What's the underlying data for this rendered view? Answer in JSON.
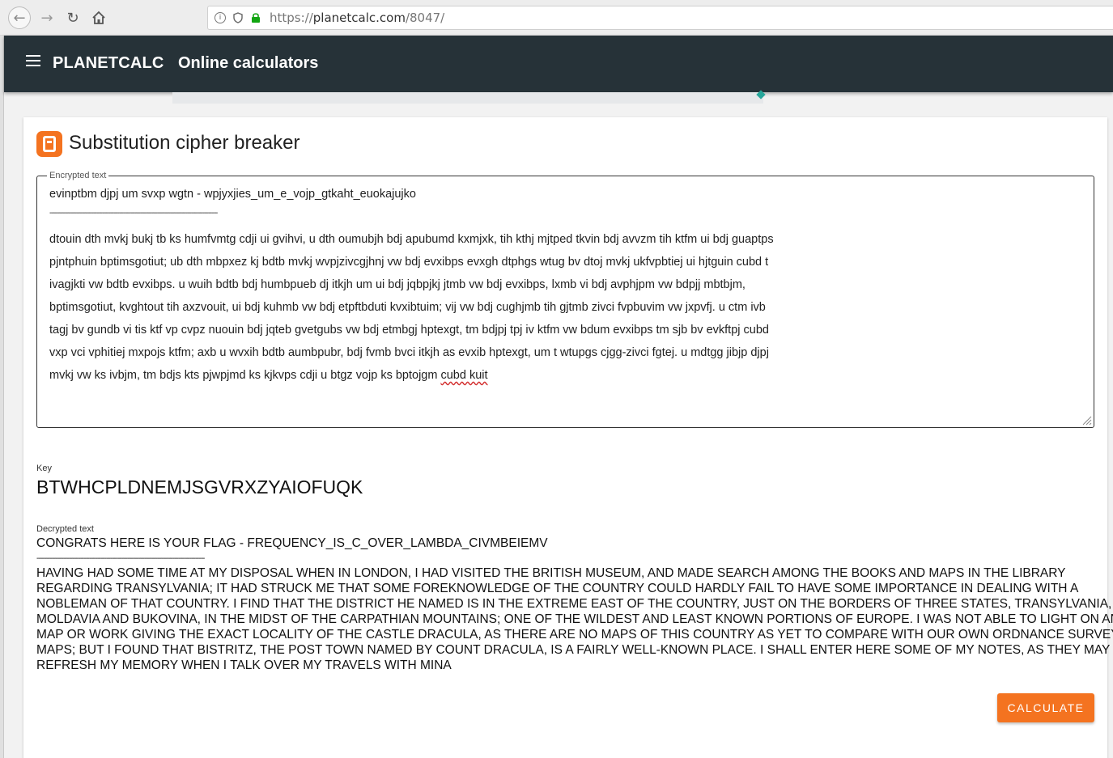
{
  "browser": {
    "url_prefix": "https://",
    "url_host": "planetcalc.com",
    "url_path": "/8047/"
  },
  "header": {
    "brand": "PLANETCALC",
    "title": "Online calculators"
  },
  "calculator": {
    "title": "Substitution cipher breaker",
    "encrypted_label": "Encrypted text",
    "encrypted_lines": [
      "evinptbm djpj um svxp wgtn - wpjyxjies_um_e_vojp_gtkaht_euokajujko",
      "-----------------------------------------------------------------------------------------",
      "dtouin dth mvkj bukj tb ks humfvmtg cdji ui gvihvi, u dth oumubjh bdj apubumd kxmjxk, tih kthj mjtped tkvin bdj avvzm tih ktfm ui bdj guaptps",
      "pjntphuin bptimsgotiut; ub dth mbpxez kj bdtb mvkj wvpjzivcgjhnj vw bdj evxibps evxgh dtphgs wtug bv dtoj mvkj ukfvpbtiej ui hjtguin cubd t",
      "ivagjkti vw bdtb evxibps. u wuih bdtb bdj humbpueb dj itkjh um ui bdj jqbpjkj jtmb vw bdj evxibps, lxmb vi bdj avphjpm vw bdpjj mbtbjm,",
      "bptimsgotiut, kvghtout tih axzvouit, ui bdj kuhmb vw bdj etpftbduti kvxibtuim; vij vw bdj cughjmb tih gjtmb zivci fvpbuvim vw jxpvfj. u ctm ivb",
      "tagj bv gundb vi tis ktf vp cvpz nuouin bdj jqteb gvetgubs vw bdj etmbgj hptexgt, tm bdjpj tpj iv ktfm vw bdum evxibps tm sjb bv evkftpj cubd",
      "vxp vci vphitiej mxpojs ktfm; axb u wvxih bdtb aumbpubr, bdj fvmb bvci itkjh as evxib hptexgt, um t wtupgs cjgg-zivci fgtej. u mdtgg jibjp djpj",
      "mvkj vw ks ivbjm, tm bdjs kts pjwpjmd ks kjkvps cdji u btgz vojp ks bptojgm"
    ],
    "encrypted_last_words": "cubd kuit",
    "key_label": "Key",
    "key_value": "BTWHCPLDNEMJSGVRXZYAIOFUQK",
    "decrypted_label": "Decrypted text",
    "decrypted_lines": [
      "CONGRATS HERE IS YOUR FLAG - FREQUENCY_IS_C_OVER_LAMBDA_CIVMBEIEMV",
      "-----------------------------------------------------------------------------------------",
      "HAVING HAD SOME TIME AT MY DISPOSAL WHEN IN LONDON, I HAD VISITED THE BRITISH MUSEUM, AND MADE SEARCH AMONG THE BOOKS AND MAPS IN THE LIBRARY",
      "REGARDING TRANSYLVANIA; IT HAD STRUCK ME THAT SOME FOREKNOWLEDGE OF THE COUNTRY COULD HARDLY FAIL TO HAVE SOME IMPORTANCE IN DEALING WITH A",
      "NOBLEMAN OF THAT COUNTRY. I FIND THAT THE DISTRICT HE NAMED IS IN THE EXTREME EAST OF THE COUNTRY, JUST ON THE BORDERS OF THREE STATES, TRANSYLVANIA,",
      "MOLDAVIA AND BUKOVINA, IN THE MIDST OF THE CARPATHIAN MOUNTAINS; ONE OF THE WILDEST AND LEAST KNOWN PORTIONS OF EUROPE. I WAS NOT ABLE TO LIGHT ON ANY",
      "MAP OR WORK GIVING THE EXACT LOCALITY OF THE CASTLE DRACULA, AS THERE ARE NO MAPS OF THIS COUNTRY AS YET TO COMPARE WITH OUR OWN ORDNANCE SURVEY",
      "MAPS; BUT I FOUND THAT BISTRITZ, THE POST TOWN NAMED BY COUNT DRACULA, IS A FAIRLY WELL-KNOWN PLACE. I SHALL ENTER HERE SOME OF MY NOTES, AS THEY MAY",
      "REFRESH MY MEMORY WHEN I TALK OVER MY TRAVELS WITH MINA"
    ],
    "calculate_label": "CALCULATE"
  }
}
